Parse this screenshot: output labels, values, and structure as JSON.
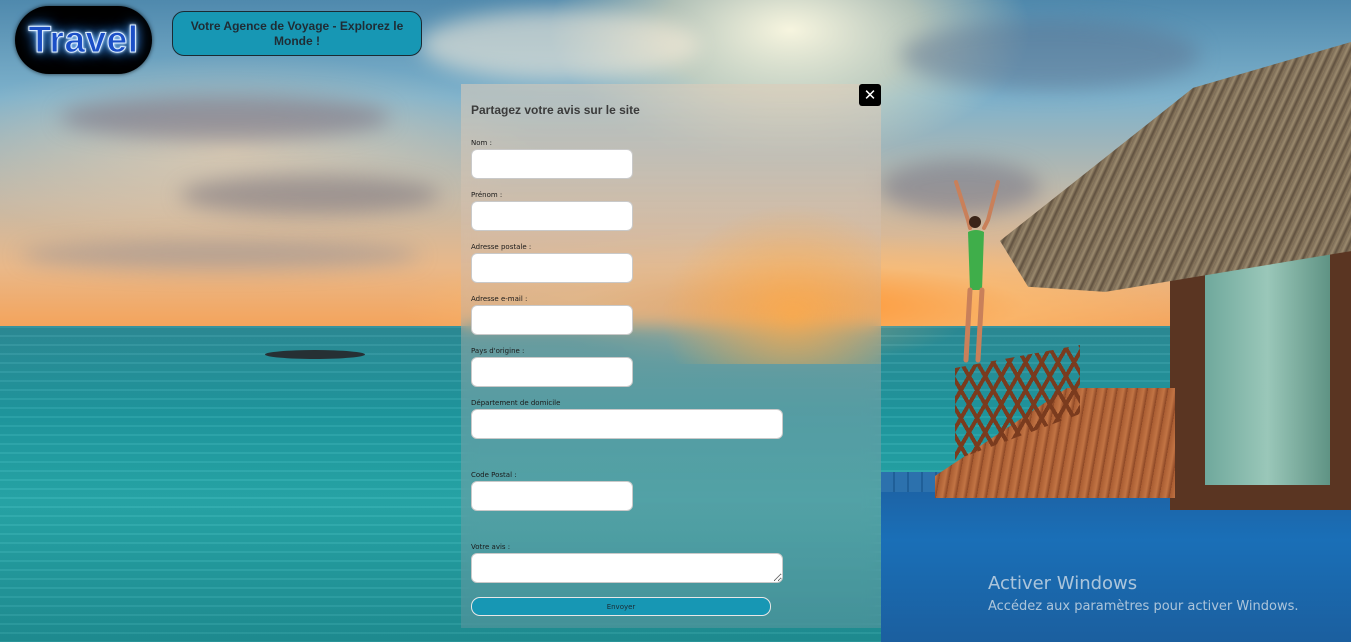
{
  "header": {
    "logo_text": "Travel",
    "tagline": "Votre Agence de Voyage - Explorez le Monde !"
  },
  "form": {
    "title": "Partagez votre avis sur le site",
    "close_glyph": "✕",
    "fields": {
      "nom": {
        "label": "Nom :",
        "value": ""
      },
      "prenom": {
        "label": "Prénom :",
        "value": ""
      },
      "adresse_postale": {
        "label": "Adresse postale :",
        "value": ""
      },
      "email": {
        "label": "Adresse e-mail :",
        "value": ""
      },
      "pays": {
        "label": "Pays d'origine :",
        "value": ""
      },
      "departement": {
        "label": "Département de domicile",
        "value": ""
      },
      "code_postal": {
        "label": "Code Postal :",
        "value": ""
      },
      "avis": {
        "label": "Votre avis :",
        "value": ""
      }
    },
    "submit_label": "Envoyer"
  },
  "watermark": {
    "title": "Activer Windows",
    "subtitle": "Accédez aux paramètres pour activer Windows."
  },
  "colors": {
    "accent": "#1797b4",
    "logo_bg": "#000000",
    "close_bg": "#000000"
  }
}
